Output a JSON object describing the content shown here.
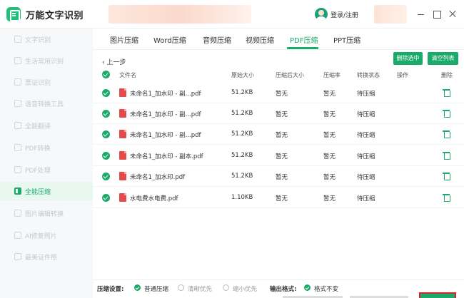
{
  "app": {
    "title": "万能文字识别"
  },
  "header": {
    "login_label": "登录/注册"
  },
  "sidebar": {
    "items": [
      {
        "label": "文字识别",
        "active": false
      },
      {
        "label": "生活常用识别",
        "active": false
      },
      {
        "label": "票证识别",
        "active": false
      },
      {
        "label": "语音转换工具",
        "active": false
      },
      {
        "label": "全能翻译",
        "active": false
      },
      {
        "label": "PDF转换",
        "active": false
      },
      {
        "label": "PDF处理",
        "active": false
      },
      {
        "label": "全能压缩",
        "active": true
      },
      {
        "label": "图片编辑转换",
        "active": false
      },
      {
        "label": "AI修复照片",
        "active": false
      },
      {
        "label": "最美证件照",
        "active": false
      }
    ]
  },
  "tabs": [
    {
      "label": "图片压缩",
      "active": false
    },
    {
      "label": "Word压缩",
      "active": false
    },
    {
      "label": "音频压缩",
      "active": false
    },
    {
      "label": "视频压缩",
      "active": false
    },
    {
      "label": "PDF压缩",
      "active": true
    },
    {
      "label": "PPT压缩",
      "active": false
    }
  ],
  "toolbar": {
    "back_label": "上一步",
    "delete_selected": "删除选中",
    "clear_list": "清空列表"
  },
  "table": {
    "headers": {
      "file_name": "文件名",
      "original_size": "原始大小",
      "compressed_size": "压缩后大小",
      "ratio": "压缩率",
      "status": "转换状态",
      "action": "操作",
      "delete": "删除"
    },
    "rows": [
      {
        "name": "未命名1_加水印 - 副...pdf",
        "size": "51.2KB",
        "compressed": "暂无",
        "ratio": "暂无",
        "status": "待压缩"
      },
      {
        "name": "未命名1_加水印 - 副...pdf",
        "size": "51.2KB",
        "compressed": "暂无",
        "ratio": "暂无",
        "status": "待压缩"
      },
      {
        "name": "未命名1_加水印 - 副...pdf",
        "size": "51.2KB",
        "compressed": "暂无",
        "ratio": "暂无",
        "status": "待压缩"
      },
      {
        "name": "未命名1_加水印 - 副本.pdf",
        "size": "51.2KB",
        "compressed": "暂无",
        "ratio": "暂无",
        "status": "待压缩"
      },
      {
        "name": "未命名1_加水印.pdf",
        "size": "51.2KB",
        "compressed": "暂无",
        "ratio": "暂无",
        "status": "待压缩"
      },
      {
        "name": "水电费水电费.pdf",
        "size": "1.10KB",
        "compressed": "暂无",
        "ratio": "暂无",
        "status": "待压缩"
      }
    ]
  },
  "settings": {
    "compress_label": "压缩设置:",
    "options": [
      "普通压缩",
      "清晰优先",
      "缩小优先"
    ],
    "selected": "普通压缩",
    "output_label": "输出格式:",
    "output_value": "格式不变"
  },
  "colors": {
    "accent": "#1aaa6a",
    "highlight_border": "#d9262b"
  }
}
